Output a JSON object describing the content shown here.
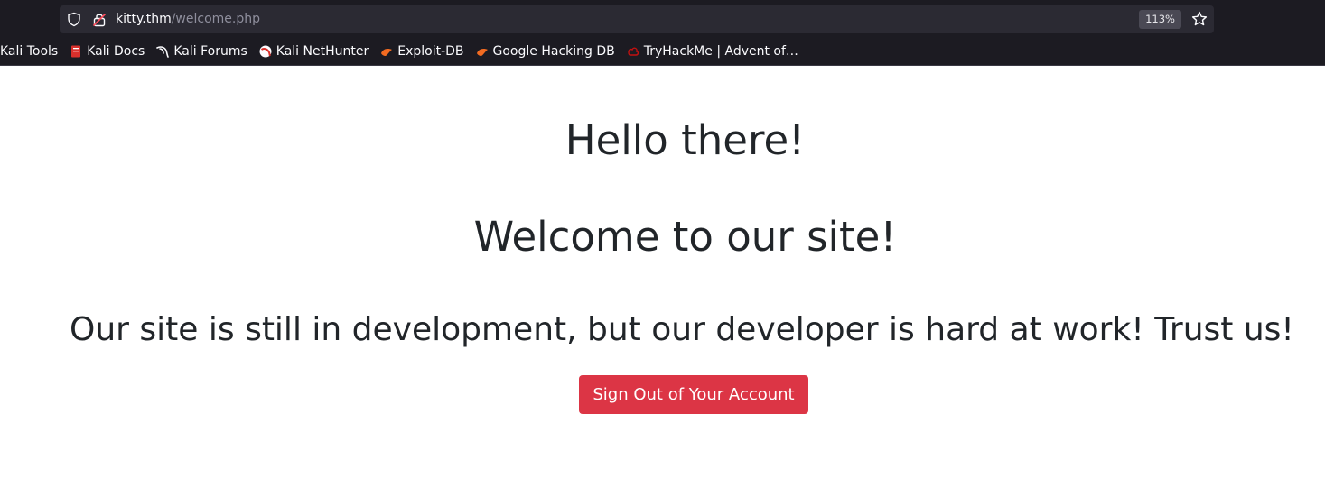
{
  "browser": {
    "url_host": "kitty.thm",
    "url_path": "/welcome.php",
    "zoom": "113%"
  },
  "bookmarks": [
    {
      "label": "Kali Tools",
      "icon": "none"
    },
    {
      "label": "Kali Docs",
      "icon": "kali-docs-icon"
    },
    {
      "label": "Kali Forums",
      "icon": "kali-dragon-icon"
    },
    {
      "label": "Kali NetHunter",
      "icon": "nethunter-icon"
    },
    {
      "label": "Exploit-DB",
      "icon": "exploit-db-icon"
    },
    {
      "label": "Google Hacking DB",
      "icon": "ghdb-icon"
    },
    {
      "label": "TryHackMe | Advent of…",
      "icon": "tryhackme-icon"
    }
  ],
  "page": {
    "greeting": "Hello there!",
    "welcome": "Welcome to our site!",
    "notice": "Our site is still in development, but our developer is hard at work! Trust us!",
    "signout_label": "Sign Out of Your Account"
  },
  "colors": {
    "chrome_bg": "#1c1b22",
    "urlbar_bg": "#2b2a33",
    "text": "#212529",
    "danger": "#dc3545"
  }
}
